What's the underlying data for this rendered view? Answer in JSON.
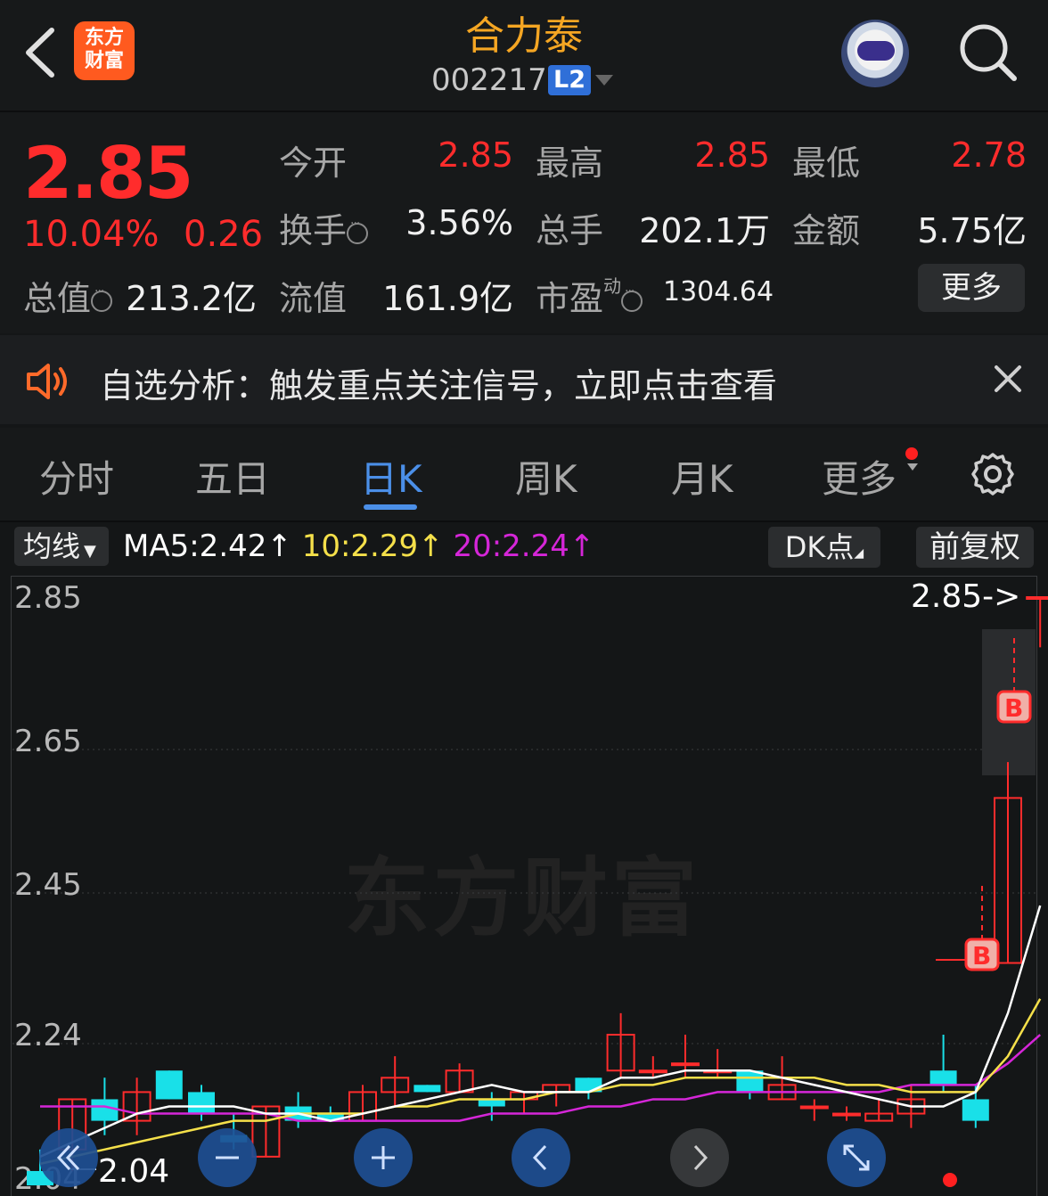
{
  "header": {
    "logo_text_1": "东方",
    "logo_text_2": "财富",
    "stock_name": "合力泰",
    "stock_code": "002217",
    "level_badge": "L2"
  },
  "quote": {
    "price": "2.85",
    "change_pct": "10.04%",
    "change_amt": "0.26",
    "stats": {
      "open_label": "今开",
      "open_value": "2.85",
      "high_label": "最高",
      "high_value": "2.85",
      "low_label": "最低",
      "low_value": "2.78",
      "turnover_label": "换手",
      "turnover_value": "3.56%",
      "volume_label": "总手",
      "volume_value": "202.1万",
      "amount_label": "金额",
      "amount_value": "5.75亿",
      "total_cap_label": "总值",
      "total_cap_value": "213.2亿",
      "float_cap_label": "流值",
      "float_cap_value": "161.9亿",
      "pe_label": "市盈",
      "pe_sup": "动",
      "pe_value": "1304.64"
    },
    "more_label": "更多"
  },
  "notice": {
    "text": "自选分析：触发重点关注信号，立即点击查看"
  },
  "tabs": [
    "分时",
    "五日",
    "日K",
    "周K",
    "月K",
    "更多"
  ],
  "active_tab": "日K",
  "ma_bar": {
    "select_label": "均线",
    "ma5": "MA5:2.42",
    "ma10": "10:2.29",
    "ma20": "20:2.24",
    "dk_label": "DK点",
    "adjust_label": "前复权"
  },
  "colors": {
    "up": "#ff2c2c",
    "down": "#19e0e8",
    "ma5": "#ffffff",
    "ma10": "#f5e04a",
    "ma20": "#d526d8",
    "accent": "#4b8fe8",
    "name": "#f5a623"
  },
  "watermark": "东方财富",
  "chart_data": {
    "type": "candlestick",
    "y_ticks": [
      "2.85",
      "2.65",
      "2.45",
      "2.24",
      "2.04"
    ],
    "ylim": [
      2.04,
      2.85
    ],
    "max_label": "2.85->",
    "min_label": "2.04",
    "signals": [
      "B",
      "B"
    ],
    "candles": [
      {
        "o": 2.05,
        "h": 2.08,
        "l": 2.03,
        "c": 2.03
      },
      {
        "o": 2.08,
        "h": 2.15,
        "l": 2.05,
        "c": 2.15
      },
      {
        "o": 2.15,
        "h": 2.18,
        "l": 2.1,
        "c": 2.12
      },
      {
        "o": 2.12,
        "h": 2.18,
        "l": 2.1,
        "c": 2.16
      },
      {
        "o": 2.19,
        "h": 2.19,
        "l": 2.15,
        "c": 2.15
      },
      {
        "o": 2.16,
        "h": 2.17,
        "l": 2.12,
        "c": 2.13
      },
      {
        "o": 2.1,
        "h": 2.13,
        "l": 2.08,
        "c": 2.09
      },
      {
        "o": 2.07,
        "h": 2.14,
        "l": 2.07,
        "c": 2.14
      },
      {
        "o": 2.14,
        "h": 2.16,
        "l": 2.11,
        "c": 2.12
      },
      {
        "o": 2.13,
        "h": 2.14,
        "l": 2.12,
        "c": 2.12
      },
      {
        "o": 2.12,
        "h": 2.17,
        "l": 2.12,
        "c": 2.16
      },
      {
        "o": 2.16,
        "h": 2.21,
        "l": 2.14,
        "c": 2.18
      },
      {
        "o": 2.17,
        "h": 2.17,
        "l": 2.16,
        "c": 2.16
      },
      {
        "o": 2.16,
        "h": 2.2,
        "l": 2.16,
        "c": 2.19
      },
      {
        "o": 2.15,
        "h": 2.16,
        "l": 2.12,
        "c": 2.14
      },
      {
        "o": 2.15,
        "h": 2.16,
        "l": 2.13,
        "c": 2.16
      },
      {
        "o": 2.16,
        "h": 2.17,
        "l": 2.14,
        "c": 2.17
      },
      {
        "o": 2.18,
        "h": 2.18,
        "l": 2.15,
        "c": 2.16
      },
      {
        "o": 2.19,
        "h": 2.27,
        "l": 2.18,
        "c": 2.24
      },
      {
        "o": 2.19,
        "h": 2.21,
        "l": 2.18,
        "c": 2.19
      },
      {
        "o": 2.2,
        "h": 2.24,
        "l": 2.18,
        "c": 2.2
      },
      {
        "o": 2.19,
        "h": 2.22,
        "l": 2.18,
        "c": 2.19
      },
      {
        "o": 2.19,
        "h": 2.19,
        "l": 2.15,
        "c": 2.16
      },
      {
        "o": 2.15,
        "h": 2.21,
        "l": 2.15,
        "c": 2.17
      },
      {
        "o": 2.14,
        "h": 2.15,
        "l": 2.12,
        "c": 2.14
      },
      {
        "o": 2.13,
        "h": 2.14,
        "l": 2.12,
        "c": 2.13
      },
      {
        "o": 2.12,
        "h": 2.15,
        "l": 2.12,
        "c": 2.13
      },
      {
        "o": 2.13,
        "h": 2.17,
        "l": 2.11,
        "c": 2.15
      },
      {
        "o": 2.19,
        "h": 2.24,
        "l": 2.16,
        "c": 2.17
      },
      {
        "o": 2.15,
        "h": 2.17,
        "l": 2.11,
        "c": 2.12
      },
      {
        "o": 2.34,
        "h": 2.62,
        "l": 2.34,
        "c": 2.57
      },
      {
        "o": 2.85,
        "h": 2.85,
        "l": 2.78,
        "c": 2.85
      }
    ],
    "ma5": [
      2.07,
      2.09,
      2.11,
      2.13,
      2.14,
      2.14,
      2.14,
      2.13,
      2.13,
      2.12,
      2.13,
      2.14,
      2.15,
      2.16,
      2.17,
      2.16,
      2.16,
      2.16,
      2.18,
      2.18,
      2.19,
      2.19,
      2.19,
      2.18,
      2.17,
      2.16,
      2.15,
      2.14,
      2.14,
      2.16,
      2.27,
      2.42
    ],
    "ma10": [
      2.06,
      2.07,
      2.08,
      2.09,
      2.1,
      2.11,
      2.12,
      2.12,
      2.13,
      2.13,
      2.13,
      2.14,
      2.14,
      2.15,
      2.15,
      2.15,
      2.16,
      2.16,
      2.17,
      2.17,
      2.18,
      2.18,
      2.18,
      2.18,
      2.18,
      2.17,
      2.17,
      2.16,
      2.16,
      2.16,
      2.21,
      2.29
    ],
    "ma20": [
      2.14,
      2.14,
      2.14,
      2.13,
      2.13,
      2.13,
      2.13,
      2.13,
      2.12,
      2.12,
      2.12,
      2.12,
      2.12,
      2.12,
      2.13,
      2.13,
      2.13,
      2.14,
      2.14,
      2.15,
      2.15,
      2.16,
      2.16,
      2.16,
      2.16,
      2.16,
      2.16,
      2.17,
      2.17,
      2.17,
      2.2,
      2.24
    ]
  }
}
